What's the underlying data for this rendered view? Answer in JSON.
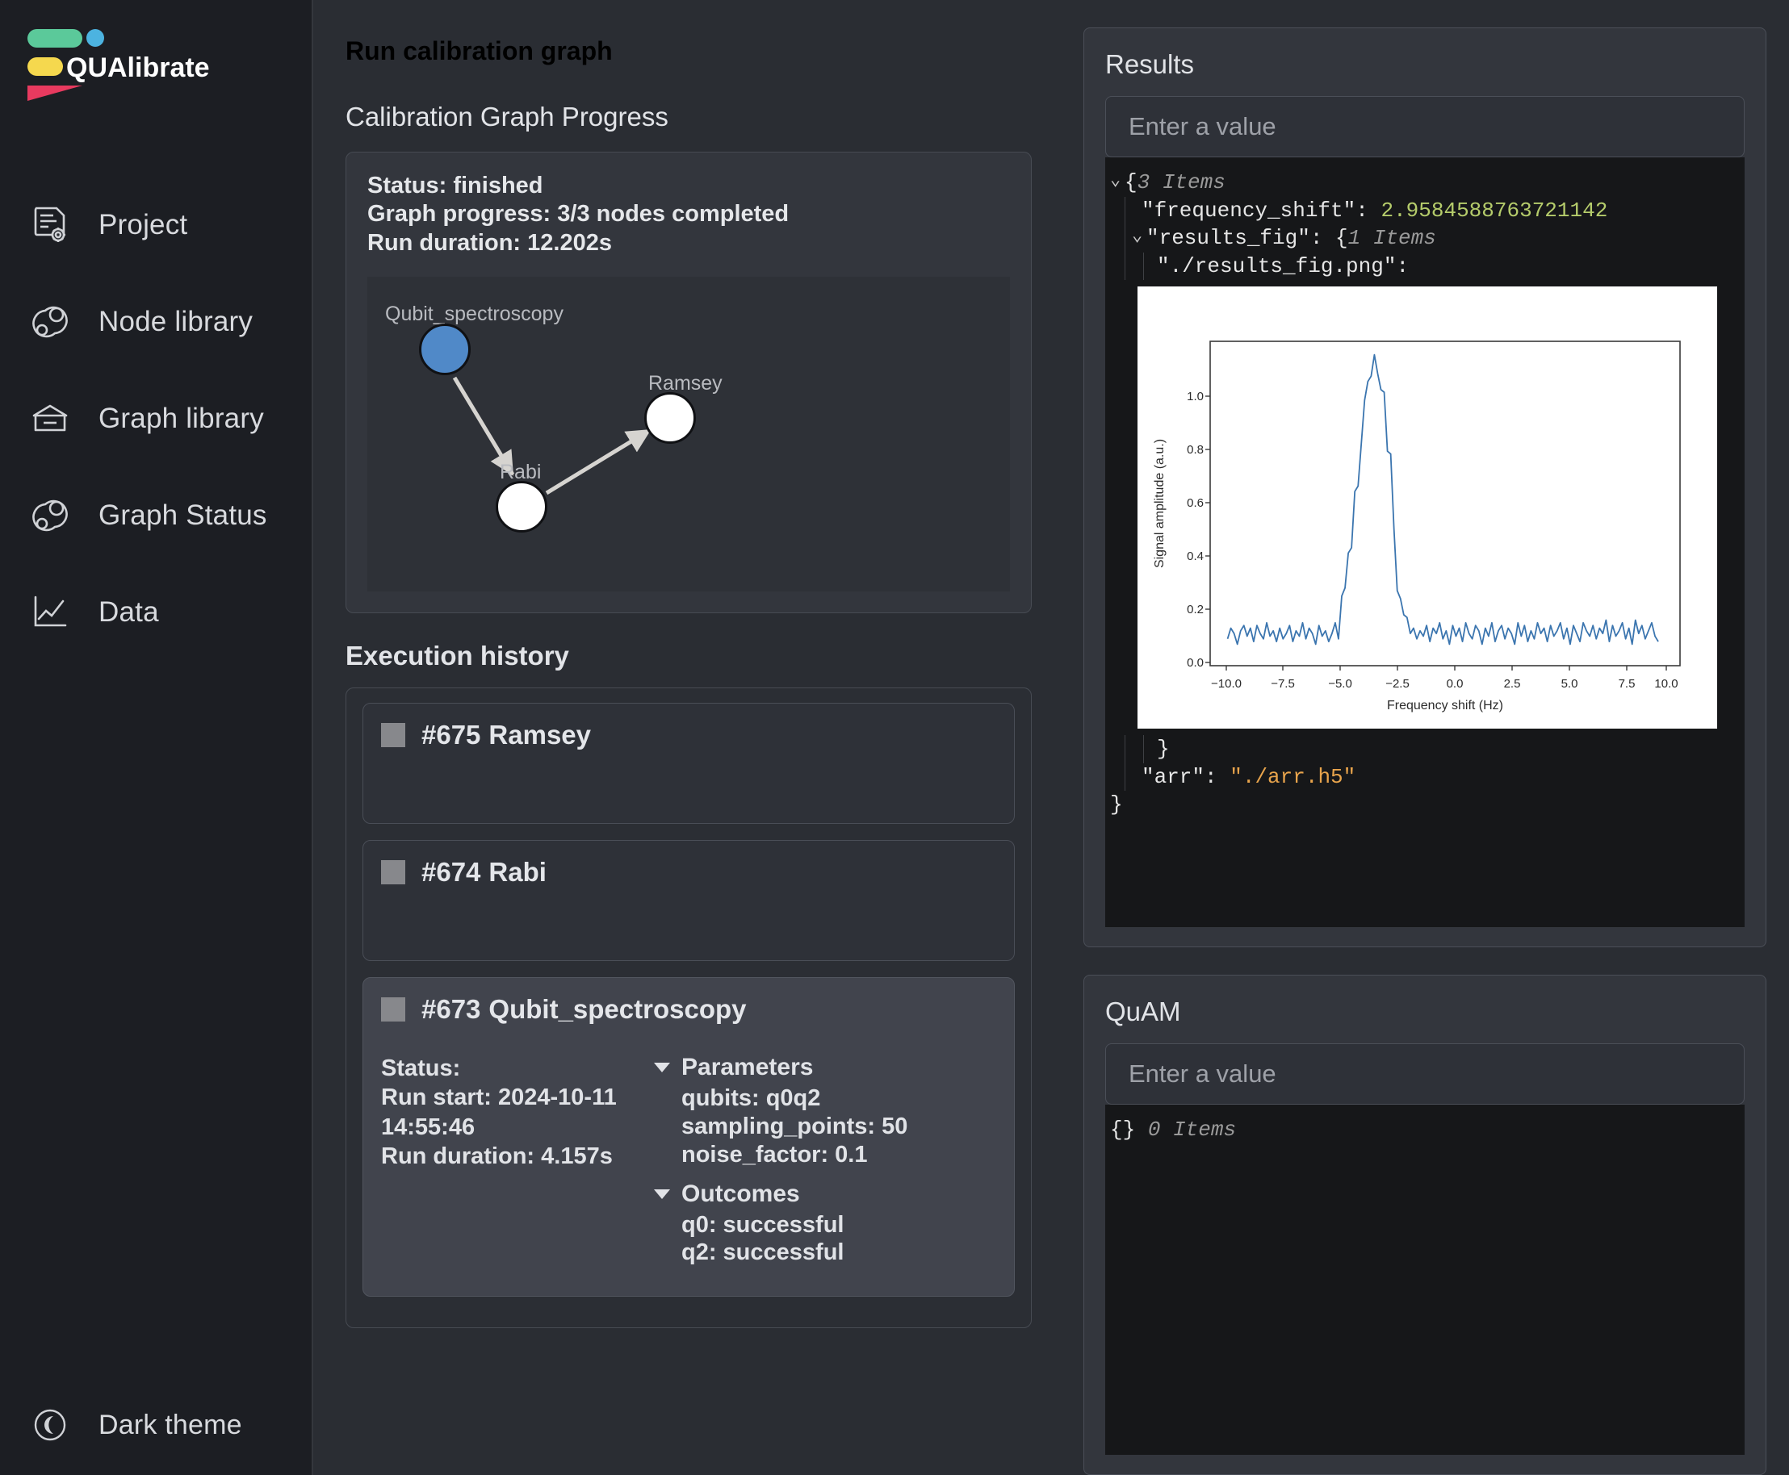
{
  "brand": {
    "name": "QUAlibrate"
  },
  "sidebar": {
    "items": [
      {
        "label": "Project",
        "icon": "document-gear-icon"
      },
      {
        "label": "Node library",
        "icon": "node-graph-icon"
      },
      {
        "label": "Graph library",
        "icon": "archive-box-icon"
      },
      {
        "label": "Graph Status",
        "icon": "node-graph-icon"
      },
      {
        "label": "Data",
        "icon": "line-chart-icon"
      }
    ],
    "theme_toggle": {
      "label": "Dark theme",
      "icon": "moon-icon"
    }
  },
  "header": {
    "title": "Run calibration graph"
  },
  "progress_section": {
    "title": "Calibration Graph Progress",
    "status": "Status: finished",
    "graph_progress": "Graph progress: 3/3 nodes completed",
    "run_duration": "Run duration: 12.202s",
    "nodes": [
      {
        "label": "Qubit_spectroscopy",
        "state": "active",
        "color": "#5089c8"
      },
      {
        "label": "Rabi",
        "state": "pending",
        "color": "#ffffff"
      },
      {
        "label": "Ramsey",
        "state": "pending",
        "color": "#ffffff"
      }
    ],
    "edges": [
      {
        "from": "Qubit_spectroscopy",
        "to": "Rabi"
      },
      {
        "from": "Rabi",
        "to": "Ramsey"
      }
    ]
  },
  "execution_history": {
    "title": "Execution history",
    "entries": [
      {
        "id": "#675",
        "name": "Ramsey",
        "expanded": false
      },
      {
        "id": "#674",
        "name": "Rabi",
        "expanded": false
      },
      {
        "id": "#673",
        "name": "Qubit_spectroscopy",
        "expanded": true,
        "status": "Status:",
        "run_start": "Run start: 2024-10-11",
        "run_start_time": "14:55:46",
        "run_duration": "Run duration: 4.157s",
        "parameters_label": "Parameters",
        "parameters": [
          "qubits: q0q2",
          "sampling_points: 50",
          "noise_factor: 0.1"
        ],
        "outcomes_label": "Outcomes",
        "outcomes": [
          "q0: successful",
          "q2: successful"
        ]
      }
    ]
  },
  "results_panel": {
    "title": "Results",
    "input_placeholder": "Enter a value",
    "root_brace": "{",
    "root_items": "3 Items",
    "frequency_shift_key": "\"frequency_shift\":",
    "frequency_shift_value": "2.9584588763721142",
    "results_fig_key": "\"results_fig\": {",
    "results_fig_items": "1 Items",
    "fig_path_key": "\"./results_fig.png\":",
    "close_inner": "}",
    "arr_key": "\"arr\":",
    "arr_value": "\"./arr.h5\"",
    "close_root": "}"
  },
  "quam_panel": {
    "title": "QuAM",
    "input_placeholder": "Enter a value",
    "empty_brace": "{}",
    "empty_items": "0 Items"
  },
  "chart_data": {
    "type": "line",
    "title": "",
    "xlabel": "Frequency shift (Hz)",
    "ylabel": "Signal amplitude (a.u.)",
    "xlim": [
      -10.8,
      10.8
    ],
    "ylim": [
      -0.07,
      1.14
    ],
    "xticks": [
      -10.0,
      -7.5,
      -5.0,
      -2.5,
      0.0,
      2.5,
      5.0,
      7.5,
      10.0
    ],
    "xticklabels": [
      "-10.0",
      "-7.5",
      "-5.0",
      "-2.5",
      "0.0",
      "2.5",
      "5.0",
      "7.5",
      "10.0"
    ],
    "yticks": [
      0.0,
      0.2,
      0.4,
      0.6,
      0.8,
      1.0
    ],
    "yticklabels": [
      "0.0",
      "0.2",
      "0.4",
      "0.6",
      "0.8",
      "1.0"
    ],
    "grid": false,
    "legend": null,
    "line_color": "#3b75af",
    "peak_center": -3.0,
    "peak_height": 1.09,
    "noise_floor": 0.05,
    "x": [
      -10.0,
      -9.85,
      -9.7,
      -9.55,
      -9.4,
      -9.25,
      -9.1,
      -8.95,
      -8.8,
      -8.65,
      -8.5,
      -8.35,
      -8.2,
      -8.05,
      -7.9,
      -7.75,
      -7.6,
      -7.45,
      -7.3,
      -7.15,
      -7.0,
      -6.85,
      -6.7,
      -6.55,
      -6.4,
      -6.25,
      -6.1,
      -5.95,
      -5.8,
      -5.65,
      -5.5,
      -5.35,
      -5.2,
      -5.05,
      -4.9,
      -4.75,
      -4.6,
      -4.45,
      -4.3,
      -4.15,
      -4.0,
      -3.85,
      -3.7,
      -3.55,
      -3.4,
      -3.25,
      -3.1,
      -2.95,
      -2.8,
      -2.65,
      -2.5,
      -2.35,
      -2.2,
      -2.05,
      -1.9,
      -1.75,
      -1.6,
      -1.45,
      -1.3,
      -1.15,
      -1.0,
      -0.85,
      -0.7,
      -0.55,
      -0.4,
      -0.25,
      -0.1,
      0.05,
      0.2,
      0.35,
      0.5,
      0.65,
      0.8,
      0.95,
      1.1,
      1.25,
      1.4,
      1.55,
      1.7,
      1.85,
      2.0,
      2.15,
      2.3,
      2.45,
      2.6,
      2.75,
      2.9,
      3.05,
      3.2,
      3.35,
      3.5,
      3.65,
      3.8,
      3.95,
      4.1,
      4.25,
      4.4,
      4.55,
      4.7,
      4.85,
      5.0,
      5.15,
      5.3,
      5.45,
      5.6,
      5.75,
      5.9,
      6.05,
      6.2,
      6.35,
      6.5,
      6.65,
      6.8,
      6.95,
      7.1,
      7.25,
      7.4,
      7.55,
      7.7,
      7.85,
      8.0,
      8.15,
      8.3,
      8.45,
      8.6,
      8.75,
      8.9,
      9.05,
      9.2,
      9.35,
      9.5,
      9.65,
      9.8,
      9.95
    ],
    "y": [
      0.03,
      0.07,
      0.05,
      0.01,
      0.06,
      0.08,
      0.04,
      0.07,
      0.02,
      0.08,
      0.05,
      0.03,
      0.09,
      0.04,
      0.06,
      0.02,
      0.07,
      0.03,
      0.05,
      0.08,
      0.02,
      0.06,
      0.04,
      0.09,
      0.03,
      0.07,
      0.05,
      0.01,
      0.08,
      0.04,
      0.06,
      0.02,
      0.05,
      0.09,
      0.03,
      0.19,
      0.22,
      0.35,
      0.37,
      0.58,
      0.6,
      0.76,
      0.92,
      0.99,
      1.01,
      1.09,
      1.02,
      0.96,
      0.95,
      0.73,
      0.72,
      0.44,
      0.21,
      0.18,
      0.12,
      0.11,
      0.05,
      0.07,
      0.03,
      0.06,
      0.04,
      0.08,
      0.02,
      0.07,
      0.05,
      0.09,
      0.03,
      0.06,
      0.01,
      0.08,
      0.04,
      0.07,
      0.02,
      0.09,
      0.05,
      0.03,
      0.08,
      0.06,
      0.01,
      0.07,
      0.04,
      0.09,
      0.02,
      0.06,
      0.08,
      0.03,
      0.07,
      0.05,
      0.01,
      0.09,
      0.04,
      0.08,
      0.02,
      0.06,
      0.03,
      0.09,
      0.05,
      0.07,
      0.02,
      0.08,
      0.04,
      0.06,
      0.09,
      0.03,
      0.07,
      0.01,
      0.08,
      0.05,
      0.02,
      0.09,
      0.06,
      0.04,
      0.08,
      0.03,
      0.07,
      0.05,
      0.1,
      0.02,
      0.08,
      0.04,
      0.06,
      0.09,
      0.03,
      0.07,
      0.01,
      0.1,
      0.05,
      0.08,
      0.03,
      0.06,
      0.09,
      0.04,
      0.02
    ]
  }
}
